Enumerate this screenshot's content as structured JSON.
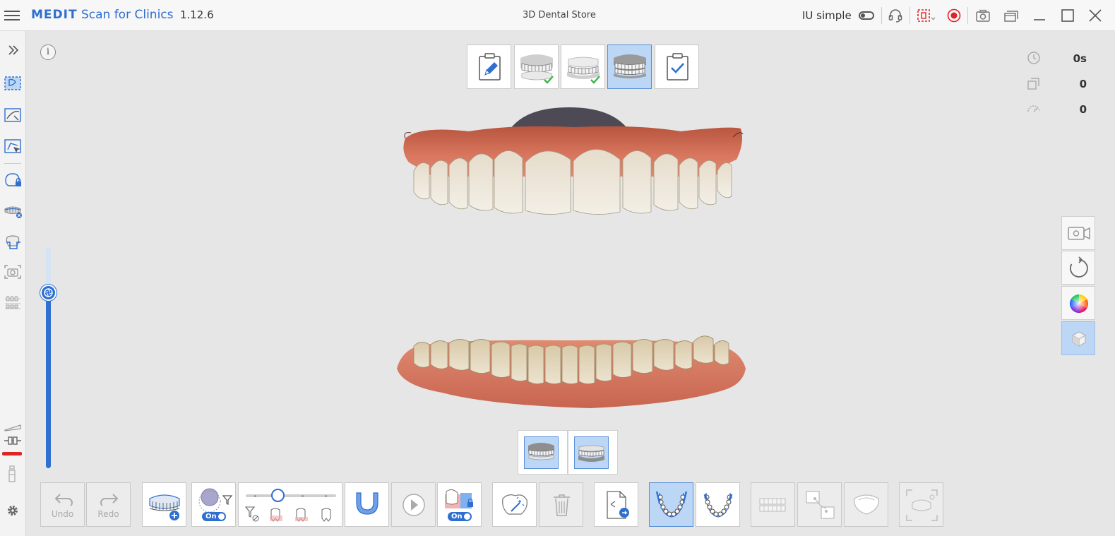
{
  "app": {
    "brand_name": "MEDIT",
    "product": "Scan for Clinics",
    "version": "1.12.6",
    "store_label": "3D Dental Store",
    "mode_label": "IU simple"
  },
  "stats": [
    {
      "icon": "clock-icon",
      "value": "0s"
    },
    {
      "icon": "shots-icon",
      "value": "0"
    },
    {
      "icon": "speed-icon",
      "value": "0"
    }
  ],
  "toolbar": {
    "undo_label": "Undo",
    "redo_label": "Redo",
    "filter_toggle": "On",
    "lock_toggle": "On"
  },
  "colors": {
    "accent": "#2f6fd0",
    "active_bg": "#bcd6f6",
    "record_red": "#e02424",
    "check_green": "#3bb54a"
  },
  "stages": [
    {
      "name": "order-form",
      "state": "default"
    },
    {
      "name": "maxilla",
      "state": "done"
    },
    {
      "name": "mandible",
      "state": "done"
    },
    {
      "name": "occlusion",
      "state": "active"
    },
    {
      "name": "review",
      "state": "default"
    }
  ]
}
